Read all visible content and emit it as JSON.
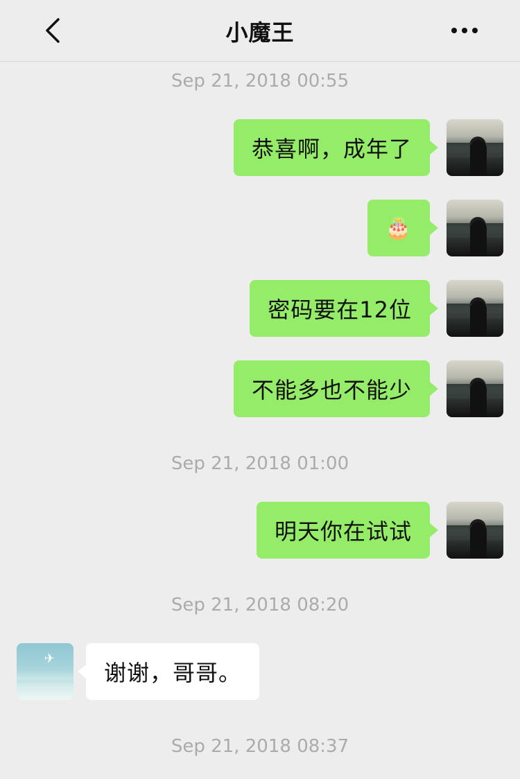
{
  "header": {
    "title": "小魔王",
    "back_icon": "chevron-left-icon",
    "more_icon": "more-dots-icon"
  },
  "timestamps": [
    "Sep 21, 2018 00:55",
    "Sep 21, 2018 01:00",
    "Sep 21, 2018 08:20",
    "Sep 21, 2018 08:37"
  ],
  "messages": [
    {
      "sender": "me",
      "text": "恭喜啊，成年了"
    },
    {
      "sender": "me",
      "text": "🎂"
    },
    {
      "sender": "me",
      "text": "密码要在12位"
    },
    {
      "sender": "me",
      "text": "不能多也不能少"
    },
    {
      "sender": "me",
      "text": "明天你在试试"
    },
    {
      "sender": "them",
      "text": "谢谢，哥哥。"
    }
  ],
  "colors": {
    "background": "#ededed",
    "outgoing_bubble": "#95ec69",
    "incoming_bubble": "#ffffff",
    "timestamp": "#ababab"
  }
}
